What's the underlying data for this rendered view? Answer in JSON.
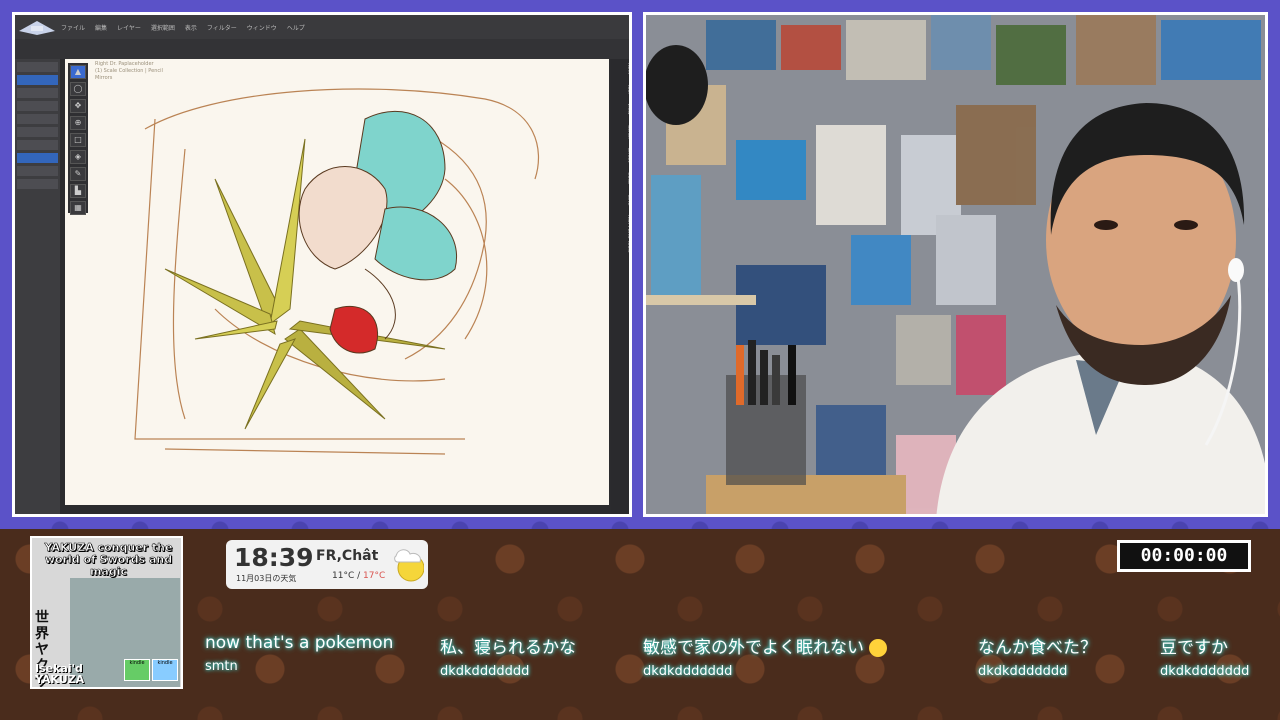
{
  "app": {
    "menu": [
      "ファイル",
      "編集",
      "レイヤー",
      "選択範囲",
      "表示",
      "フィルター",
      "ウィンドウ",
      "ヘルプ"
    ],
    "canvas_info": [
      "Right Dr. Paplaceholder",
      "(1) Scale Collection | Pencil",
      "Mirrors"
    ],
    "right_tabs": [
      "Item",
      "Tool",
      "View",
      "Scroll",
      "Effect",
      "Color",
      "Line",
      "NOPPERS Tools"
    ],
    "tools": [
      "▲",
      "◯",
      "✥",
      "⊕",
      "□",
      "◈",
      "✎",
      "▙",
      "▦"
    ]
  },
  "cover": {
    "title": "YAKUZA conquer the world of Swords and magic",
    "kanji": "世界ヤクザ異",
    "subtitle_line1": "Isekai'd",
    "subtitle_line2": "YAKUZA",
    "badge1": "kindle",
    "badge2": "kindle"
  },
  "clock": {
    "time": "18:39",
    "city": "FR,Chât",
    "date": "11月03日の天気",
    "temp_low": "11°C",
    "sep": "/",
    "temp_high": "17°C"
  },
  "timer": {
    "value": "00:00:00"
  },
  "chat": [
    {
      "msg": "now that's a pokemon",
      "user": "smtn"
    },
    {
      "msg": "私、寝られるかな",
      "user": "dkdkddddddd"
    },
    {
      "msg": "敏感で家の外でよく眠れない",
      "user": "dkdkddddddd",
      "emoji": true
    },
    {
      "msg": "なんか食べた？",
      "user": "dkdkddddddd"
    },
    {
      "msg": "豆ですか",
      "user": "dkdkddddddd"
    }
  ],
  "colors": {
    "frame": "#5b52c8",
    "band": "#4a2c1c",
    "chat_glow": "#3fd6d0",
    "canvas": "#faf6ee"
  }
}
